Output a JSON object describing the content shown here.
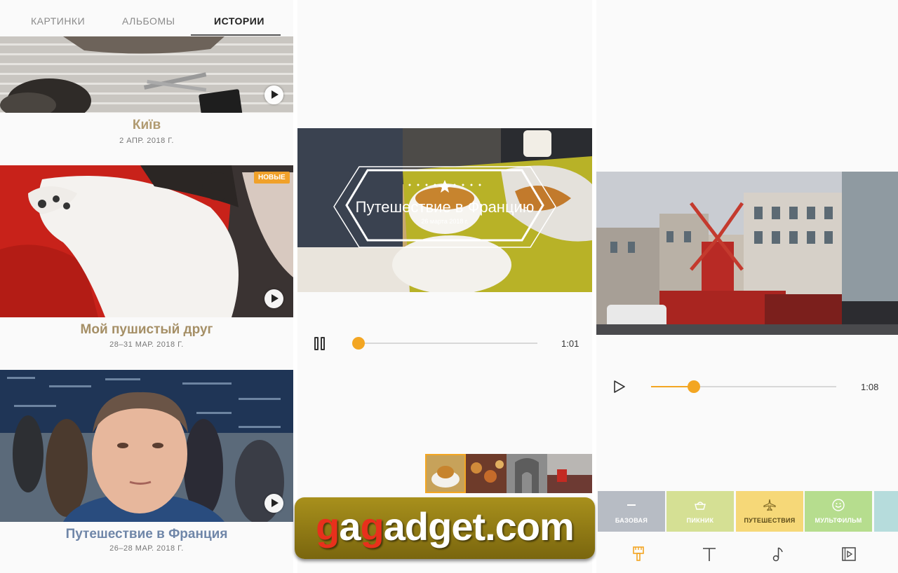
{
  "gallery": {
    "tabs": [
      "КАРТИНКИ",
      "АЛЬБОМЫ",
      "ИСТОРИИ"
    ],
    "active_tab": "ИСТОРИИ",
    "stories": [
      {
        "title": "Київ",
        "date": "2 АПР. 2018 Г.",
        "title_color": "#b09a70"
      },
      {
        "title": "Мой пушистый друг",
        "date": "28–31 МАР. 2018 Г.",
        "title_color": "#a58f66",
        "badge": "НОВЫЕ"
      },
      {
        "title": "Путешествие в Франция",
        "date": "26–28 МАР. 2018 Г.",
        "title_color": "#6f86a8"
      }
    ]
  },
  "player": {
    "video_title": "Путешествие в Францию",
    "video_date": "26 марта 2018 г.",
    "duration": "1:01",
    "progress": 0.0,
    "accent": "#f3a623"
  },
  "watermark": {
    "part1": "g",
    "part2": "a",
    "part3": "g",
    "part4": "adget.com"
  },
  "editor": {
    "duration": "1:08",
    "progress": 0.23,
    "themes": [
      {
        "label": "БАЗОВАЯ",
        "color": "#b7bcc4",
        "icon": "minus-icon"
      },
      {
        "label": "ПИКНИК",
        "color": "#d5e094",
        "icon": "basket-icon"
      },
      {
        "label": "ПУТЕШЕСТВИЯ",
        "color": "#f6d878",
        "icon": "airplane-icon"
      },
      {
        "label": "МУЛЬТФИЛЬМ",
        "color": "#b6dd8e",
        "icon": "smiley-icon"
      }
    ],
    "tools": [
      "brush-icon",
      "text-icon",
      "music-note-icon",
      "film-edit-icon"
    ]
  }
}
